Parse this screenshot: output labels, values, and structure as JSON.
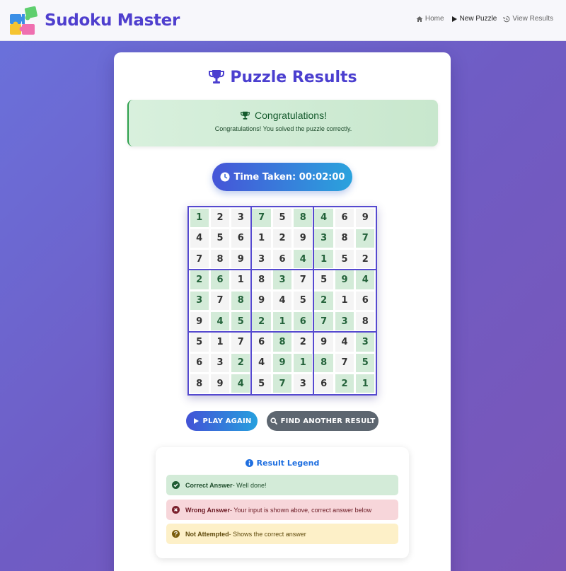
{
  "brand": {
    "title": "Sudoku Master"
  },
  "nav": {
    "home": "Home",
    "new_puzzle": "New Puzzle",
    "view_results": "View Results"
  },
  "result": {
    "title": "Puzzle Results",
    "alert_title": "Congratulations!",
    "alert_message": "Congratulations! You solved the puzzle correctly.",
    "time_label": "Time Taken: 00:02:00"
  },
  "board": {
    "values": [
      [
        1,
        2,
        3,
        7,
        5,
        8,
        4,
        6,
        9
      ],
      [
        4,
        5,
        6,
        1,
        2,
        9,
        3,
        8,
        7
      ],
      [
        7,
        8,
        9,
        3,
        6,
        4,
        1,
        5,
        2
      ],
      [
        2,
        6,
        1,
        8,
        3,
        7,
        5,
        9,
        4
      ],
      [
        3,
        7,
        8,
        9,
        4,
        5,
        2,
        1,
        6
      ],
      [
        9,
        4,
        5,
        2,
        1,
        6,
        7,
        3,
        8
      ],
      [
        5,
        1,
        7,
        6,
        8,
        2,
        9,
        4,
        3
      ],
      [
        6,
        3,
        2,
        4,
        9,
        1,
        8,
        7,
        5
      ],
      [
        8,
        9,
        4,
        5,
        7,
        3,
        6,
        2,
        1
      ]
    ],
    "status": [
      [
        "c",
        "g",
        "g",
        "c",
        "g",
        "c",
        "c",
        "g",
        "g"
      ],
      [
        "g",
        "g",
        "g",
        "g",
        "g",
        "g",
        "c",
        "g",
        "c"
      ],
      [
        "g",
        "g",
        "g",
        "g",
        "g",
        "c",
        "c",
        "g",
        "g"
      ],
      [
        "c",
        "c",
        "g",
        "g",
        "c",
        "g",
        "g",
        "c",
        "c"
      ],
      [
        "c",
        "g",
        "c",
        "g",
        "g",
        "g",
        "c",
        "g",
        "g"
      ],
      [
        "g",
        "c",
        "c",
        "c",
        "c",
        "c",
        "c",
        "c",
        "g"
      ],
      [
        "g",
        "g",
        "g",
        "g",
        "c",
        "g",
        "g",
        "g",
        "c"
      ],
      [
        "g",
        "g",
        "c",
        "g",
        "c",
        "c",
        "c",
        "g",
        "c"
      ],
      [
        "g",
        "g",
        "c",
        "g",
        "c",
        "g",
        "g",
        "c",
        "c"
      ]
    ]
  },
  "buttons": {
    "play_again": "PLAY AGAIN",
    "find_another": "FIND ANOTHER RESULT"
  },
  "legend": {
    "title": "Result Legend",
    "correct_label": "Correct Answer",
    "correct_desc": "- Well done!",
    "wrong_label": "Wrong Answer",
    "wrong_desc": "- Your input is shown above, correct answer below",
    "na_label": "Not Attempted",
    "na_desc": "- Shows the correct answer"
  },
  "colors": {
    "brand": "#4f3fce",
    "correct_bg": "#d3ebd8",
    "wrong_bg": "#f7d6da",
    "not_attempted_bg": "#fdf0c8"
  },
  "icons": {
    "logo": "puzzle-pieces-icon",
    "home": "home-icon",
    "new_puzzle": "play-icon",
    "view_results": "history-icon",
    "title": "trophy-icon",
    "time": "clock-icon",
    "find": "search-icon",
    "legend": "info-icon"
  }
}
